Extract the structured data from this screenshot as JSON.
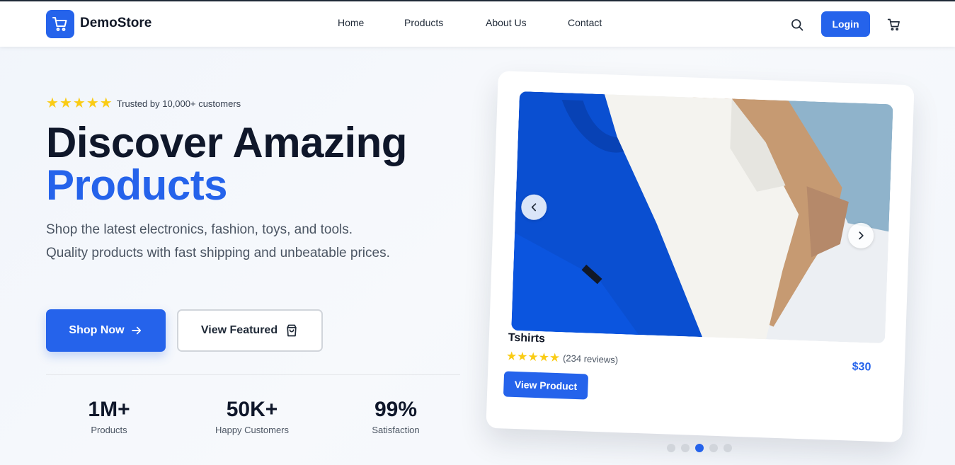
{
  "header": {
    "brand": "DemoStore",
    "nav": [
      "Home",
      "Products",
      "About Us",
      "Contact"
    ],
    "login_label": "Login",
    "icons": {
      "logo": "cart-icon",
      "search": "search-icon",
      "cart": "cart-icon"
    }
  },
  "hero": {
    "rating_stars": 5,
    "trust_text": "Trusted by 10,000+ customers",
    "headline_line1": "Discover Amazing",
    "headline_line2": "Products",
    "subtext": "Shop the latest electronics, fashion, toys, and tools. Quality products with fast shipping and unbeatable prices.",
    "shop_now_label": "Shop Now",
    "view_featured_label": "View Featured",
    "stats": [
      {
        "value": "1M+",
        "label": "Products"
      },
      {
        "value": "50K+",
        "label": "Happy Customers"
      },
      {
        "value": "99%",
        "label": "Satisfaction"
      }
    ]
  },
  "carousel": {
    "product_name": "Tshirts",
    "rating_stars": 5,
    "reviews": "(234 reviews)",
    "price": "$30",
    "view_product_label": "View Product",
    "slide_count": 5,
    "active_slide": 3
  },
  "colors": {
    "accent": "#2563eb",
    "star": "#facc15",
    "heading": "#0f172a"
  }
}
